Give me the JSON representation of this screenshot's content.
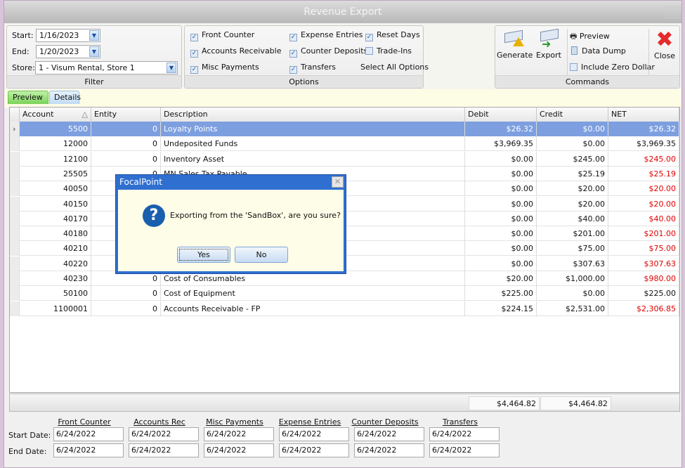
{
  "window": {
    "title": "Revenue Export",
    "close_glyph": "✕"
  },
  "filter": {
    "caption": "Filter",
    "start_label": "Start:",
    "start_value": "1/16/2023",
    "end_label": "End:",
    "end_value": "1/20/2023",
    "store_label": "Store:",
    "store_value": "1 - Visum Rental, Store 1"
  },
  "options": {
    "caption": "Options",
    "items": [
      {
        "label": "Front Counter",
        "checked": true
      },
      {
        "label": "Accounts Receivable",
        "checked": true
      },
      {
        "label": "Misc Payments",
        "checked": true
      },
      {
        "label": "Expense Entries",
        "checked": true
      },
      {
        "label": "Counter Deposits",
        "checked": true
      },
      {
        "label": "Transfers",
        "checked": true
      },
      {
        "label": "Reset Days",
        "checked": true
      },
      {
        "label": "Trade-Ins",
        "checked": false
      }
    ],
    "select_all": "Select All Options"
  },
  "commands": {
    "caption": "Commands",
    "generate": "Generate",
    "export": "Export",
    "preview": "Preview",
    "data_dump": "Data Dump",
    "include_zero": "Include Zero Dollar",
    "include_zero_checked": false,
    "close": "Close"
  },
  "tabs": [
    {
      "label": "Preview",
      "active": false
    },
    {
      "label": "Details",
      "active": true
    }
  ],
  "grid": {
    "columns": [
      "Account",
      "Entity",
      "Description",
      "Debit",
      "Credit",
      "NET"
    ],
    "sort_glyph": "△",
    "rows": [
      [
        "5500",
        "0",
        "Loyalty Points",
        "$26.32",
        "$0.00",
        "$26.32"
      ],
      [
        "12000",
        "0",
        "Undeposited Funds",
        "$3,969.35",
        "$0.00",
        "$3,969.35"
      ],
      [
        "12100",
        "0",
        "Inventory Asset",
        "$0.00",
        "$245.00",
        "$245.00"
      ],
      [
        "25505",
        "0",
        "MN Sales Tax Payable",
        "$0.00",
        "$25.19",
        "$25.19"
      ],
      [
        "40050",
        "",
        "",
        "$0.00",
        "$20.00",
        "$20.00"
      ],
      [
        "40150",
        "",
        "",
        "$0.00",
        "$20.00",
        "$20.00"
      ],
      [
        "40170",
        "",
        "",
        "$0.00",
        "$40.00",
        "$40.00"
      ],
      [
        "40180",
        "",
        "",
        "$0.00",
        "$201.00",
        "$201.00"
      ],
      [
        "40210",
        "",
        "",
        "$0.00",
        "$75.00",
        "$75.00"
      ],
      [
        "40220",
        "",
        "",
        "$0.00",
        "$307.63",
        "$307.63"
      ],
      [
        "40230",
        "0",
        "Cost of Consumables",
        "$20.00",
        "$1,000.00",
        "$980.00"
      ],
      [
        "50100",
        "0",
        "Cost of Equipment",
        "$225.00",
        "$0.00",
        "$225.00"
      ],
      [
        "1100001",
        "0",
        "Accounts Receivable - FP",
        "$224.15",
        "$2,531.00",
        "$2,306.85"
      ]
    ],
    "negative_rows": [
      2,
      3,
      4,
      5,
      6,
      7,
      8,
      9,
      10,
      12
    ],
    "selected_row": 0,
    "totals": {
      "debit": "$4,464.82",
      "credit": "$4,464.82"
    }
  },
  "last_dates": {
    "columns": [
      "Front Counter",
      "Accounts Rec",
      "Misc Payments",
      "Expense Entries",
      "Counter Deposits",
      "Transfers"
    ],
    "start_label": "Start Date:",
    "end_label": "End Date:",
    "start": [
      "6/24/2022",
      "6/24/2022",
      "6/24/2022",
      "6/24/2022",
      "6/24/2022",
      "6/24/2022"
    ],
    "end": [
      "6/24/2022",
      "6/24/2022",
      "6/24/2022",
      "6/24/2022",
      "6/24/2022",
      "6/24/2022"
    ]
  },
  "dialog": {
    "title": "FocalPoint",
    "message": "Exporting from the 'SandBox', are you sure?",
    "yes": "Yes",
    "no": "No",
    "icon": "question-icon",
    "close_glyph": "✕"
  },
  "colors": {
    "selection": "#7d9fe0",
    "negative": "#e00000",
    "dialog_frame": "#2f6fd0"
  }
}
